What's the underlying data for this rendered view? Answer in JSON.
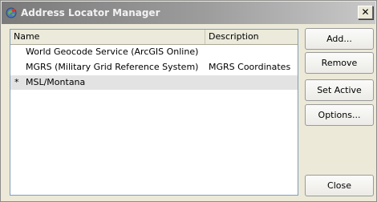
{
  "window": {
    "title": "Address Locator Manager",
    "close_label": "✕"
  },
  "list": {
    "columns": [
      "Name",
      "Description"
    ],
    "rows": [
      {
        "name": "World Geocode Service (ArcGIS Online)",
        "description": "",
        "active_marker": ""
      },
      {
        "name": "MGRS (Military Grid Reference System)",
        "description": "MGRS Coordinates",
        "active_marker": ""
      },
      {
        "name": "MSL/Montana",
        "description": "",
        "active_marker": "*"
      }
    ],
    "selected_index": 2
  },
  "buttons": {
    "add": "Add...",
    "remove": "Remove",
    "set_active": "Set Active",
    "options": "Options...",
    "close": "Close"
  },
  "colors": {
    "title_bar_start": "#7a7a7a",
    "title_bar_end": "#c9c9c9",
    "dialog_background": "#ece9d8",
    "selected_row": "#e3e3e3"
  }
}
